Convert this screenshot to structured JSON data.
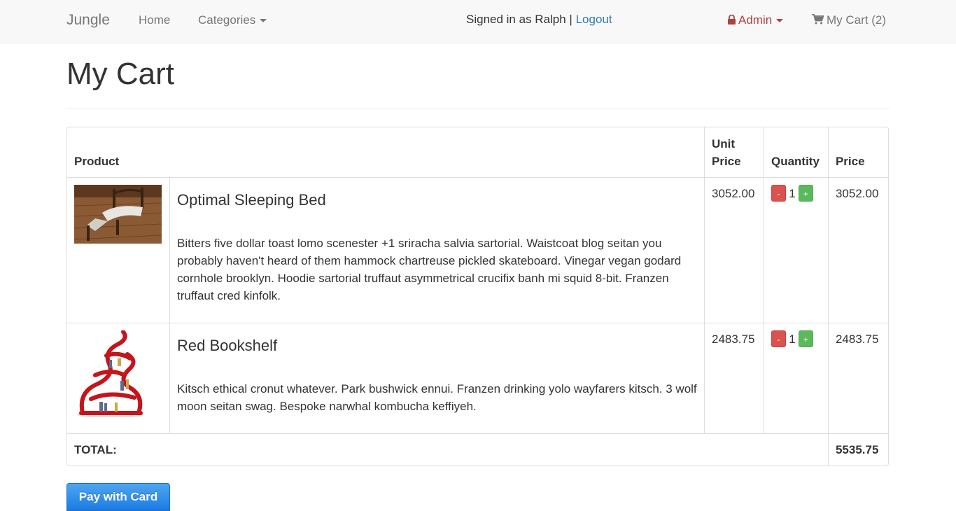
{
  "navbar": {
    "brand": "Jungle",
    "home": "Home",
    "categories": "Categories",
    "signed_in_prefix": "Signed in as Ralph |",
    "logout": "Logout",
    "admin": "Admin",
    "cart": "My Cart (2)"
  },
  "page": {
    "title": "My Cart"
  },
  "table": {
    "headers": {
      "product": "Product",
      "unit_price_line1": "Unit",
      "unit_price_line2": "Price",
      "quantity": "Quantity",
      "price": "Price"
    },
    "items": [
      {
        "image": "bed-photo",
        "name": "Optimal Sleeping Bed",
        "description": "Bitters five dollar toast lomo scenester +1 sriracha salvia sartorial. Waistcoat blog seitan you probably haven't heard of them hammock chartreuse pickled skateboard. Vinegar vegan godard cornhole brooklyn. Hoodie sartorial truffaut asymmetrical crucifix banh mi squid 8-bit. Franzen truffaut cred kinfolk.",
        "unit_price": "3052.00",
        "quantity": "1",
        "price": "3052.00"
      },
      {
        "image": "red-bookshelf-photo",
        "name": "Red Bookshelf",
        "description": "Kitsch ethical cronut whatever. Park bushwick ennui. Franzen drinking yolo wayfarers kitsch. 3 wolf moon seitan swag. Bespoke narwhal kombucha keffiyeh.",
        "unit_price": "2483.75",
        "quantity": "1",
        "price": "2483.75"
      }
    ],
    "decrement_label": "-",
    "increment_label": "+",
    "total_label": "TOTAL:",
    "total_value": "5535.75"
  },
  "pay_button": "Pay with Card",
  "colors": {
    "navbar_bg": "#f8f8f8",
    "link": "#337ab7",
    "admin": "#a94442",
    "minus": "#d9534f",
    "plus": "#5cb85c",
    "pay": "#1b7be3"
  }
}
